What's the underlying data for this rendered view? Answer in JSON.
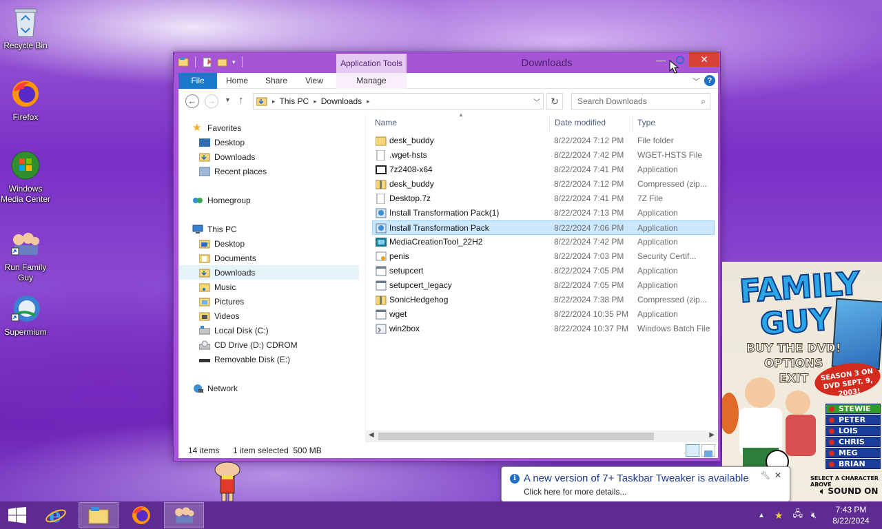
{
  "desktop": {
    "icons": [
      {
        "label": "Recycle Bin"
      },
      {
        "label": "Firefox"
      },
      {
        "label": "Windows Media Center"
      },
      {
        "label": "Run Family Guy"
      },
      {
        "label": "Supermium"
      }
    ]
  },
  "window": {
    "title": "Downloads",
    "context_tab": "Application Tools",
    "ribbon_tabs": [
      "File",
      "Home",
      "Share",
      "View",
      "Manage"
    ],
    "address": {
      "crumbs": [
        "This PC",
        "Downloads"
      ]
    },
    "search_placeholder": "Search Downloads",
    "nav": {
      "favorites": "Favorites",
      "fav_items": [
        "Desktop",
        "Downloads",
        "Recent places"
      ],
      "homegroup": "Homegroup",
      "this_pc": "This PC",
      "pc_items": [
        "Desktop",
        "Documents",
        "Downloads",
        "Music",
        "Pictures",
        "Videos",
        "Local Disk (C:)",
        "CD Drive (D:) CDROM",
        "Removable Disk (E:)"
      ],
      "network": "Network"
    },
    "columns": {
      "name": "Name",
      "date": "Date modified",
      "type": "Type"
    },
    "files": [
      {
        "name": "desk_buddy",
        "date": "8/22/2024 7:12 PM",
        "type": "File folder",
        "icon": "folder-icon"
      },
      {
        "name": ".wget-hsts",
        "date": "8/22/2024 7:42 PM",
        "type": "WGET-HSTS File",
        "icon": "file-icon"
      },
      {
        "name": "7z2408-x64",
        "date": "8/22/2024 7:41 PM",
        "type": "Application",
        "icon": "7zip-icon"
      },
      {
        "name": "desk_buddy",
        "date": "8/22/2024 7:12 PM",
        "type": "Compressed (zipped) Folder",
        "icon": "zip-folder-icon"
      },
      {
        "name": "Desktop.7z",
        "date": "8/22/2024 7:41 PM",
        "type": "7Z File",
        "icon": "file-icon"
      },
      {
        "name": "Install Transformation Pack(1)",
        "date": "8/22/2024 7:13 PM",
        "type": "Application",
        "icon": "installer-icon"
      },
      {
        "name": "Install Transformation Pack",
        "date": "8/22/2024 7:06 PM",
        "type": "Application",
        "icon": "installer-icon",
        "selected": true
      },
      {
        "name": "MediaCreationTool_22H2",
        "date": "8/22/2024 7:42 PM",
        "type": "Application",
        "icon": "media-tool-icon"
      },
      {
        "name": "penis",
        "date": "8/22/2024 7:03 PM",
        "type": "Security Certificate",
        "icon": "certificate-icon"
      },
      {
        "name": "setupcert",
        "date": "8/22/2024 7:05 PM",
        "type": "Application",
        "icon": "app-icon"
      },
      {
        "name": "setupcert_legacy",
        "date": "8/22/2024 7:05 PM",
        "type": "Application",
        "icon": "app-icon"
      },
      {
        "name": "SonicHedgehog",
        "date": "8/22/2024 7:38 PM",
        "type": "Compressed (zipped) Folder",
        "icon": "zip-folder-icon"
      },
      {
        "name": "wget",
        "date": "8/22/2024 10:35 PM",
        "type": "Application",
        "icon": "app-icon"
      },
      {
        "name": "win2box",
        "date": "8/22/2024 10:37 PM",
        "type": "Windows Batch File",
        "icon": "batch-icon"
      }
    ],
    "status": {
      "count": "14 items",
      "selection": "1 item selected  500 MB"
    }
  },
  "banner": {
    "logo_line1": "FAMILY",
    "logo_line2": "GUY",
    "menu": [
      "BUY THE DVD!",
      "OPTIONS",
      "EXIT"
    ],
    "promo": "SEASON 3 ON DVD SEPT. 9, 2003!",
    "characters": [
      "STEWIE",
      "PETER",
      "LOIS",
      "CHRIS",
      "MEG",
      "BRIAN"
    ],
    "select_text": "SELECT A CHARACTER ABOVE",
    "sound": "SOUND ON"
  },
  "toast": {
    "title": "A new version of 7+ Taskbar Tweaker is available",
    "subtitle": "Click here for more details..."
  },
  "clock": {
    "time": "7:43 PM",
    "date": "8/22/2024"
  },
  "colors": {
    "accent": "#1979ca",
    "window_frame": "#a655d6",
    "close": "#d8413a",
    "selection": "#cce8ff"
  }
}
